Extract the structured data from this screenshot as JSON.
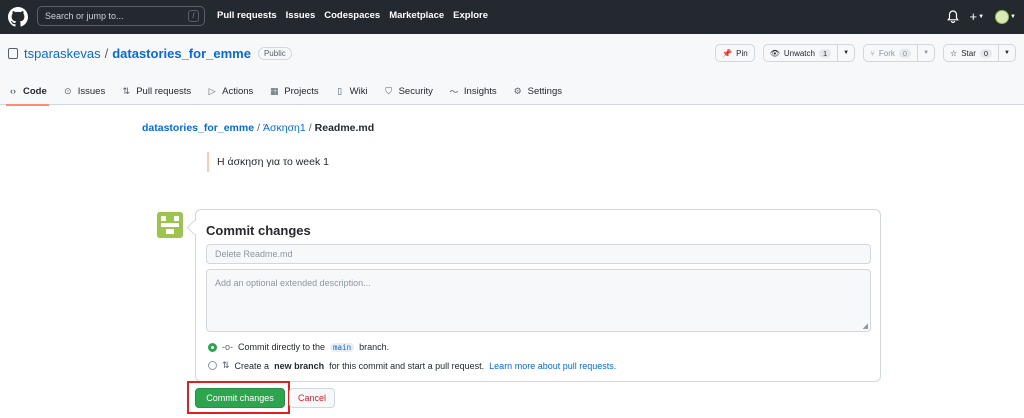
{
  "header": {
    "search_placeholder": "Search or jump to...",
    "search_shortcut": "/",
    "nav": [
      "Pull requests",
      "Issues",
      "Codespaces",
      "Marketplace",
      "Explore"
    ],
    "plus": "+"
  },
  "repo": {
    "owner": "tsparaskevas",
    "separator": "/",
    "name": "datastories_for_emme",
    "visibility": "Public",
    "pin_label": "Pin",
    "watch_label": "Unwatch",
    "watch_count": "1",
    "fork_label": "Fork",
    "fork_count": "0",
    "star_label": "Star",
    "star_count": "0"
  },
  "tabs": [
    {
      "label": "Code",
      "icon": "code-icon"
    },
    {
      "label": "Issues",
      "icon": "issue-icon"
    },
    {
      "label": "Pull requests",
      "icon": "pull-request-icon"
    },
    {
      "label": "Actions",
      "icon": "play-icon"
    },
    {
      "label": "Projects",
      "icon": "table-icon"
    },
    {
      "label": "Wiki",
      "icon": "book-icon"
    },
    {
      "label": "Security",
      "icon": "shield-icon"
    },
    {
      "label": "Insights",
      "icon": "graph-icon"
    },
    {
      "label": "Settings",
      "icon": "gear-icon"
    }
  ],
  "breadcrumb": {
    "root": "datastories_for_emme",
    "folder": "Άσκηση1",
    "file": "Readme.md",
    "sep": "/"
  },
  "readme_preview": "Η άσκηση για το week 1",
  "commit": {
    "title": "Commit changes",
    "message_placeholder": "Delete Readme.md",
    "description_placeholder": "Add an optional extended description...",
    "option_direct_pre": "Commit directly to the",
    "option_direct_branch": "main",
    "option_direct_post": "branch.",
    "option_new_pre": "Create a",
    "option_new_bold": "new branch",
    "option_new_post": "for this commit and start a pull request.",
    "option_new_link": "Learn more about pull requests.",
    "submit_label": "Commit changes",
    "cancel_label": "Cancel"
  },
  "colors": {
    "header_bg": "#24292f",
    "accent_blue": "#0969da",
    "primary_green": "#2da44e",
    "danger_red": "#cf222e",
    "highlight_red": "#e02020"
  }
}
